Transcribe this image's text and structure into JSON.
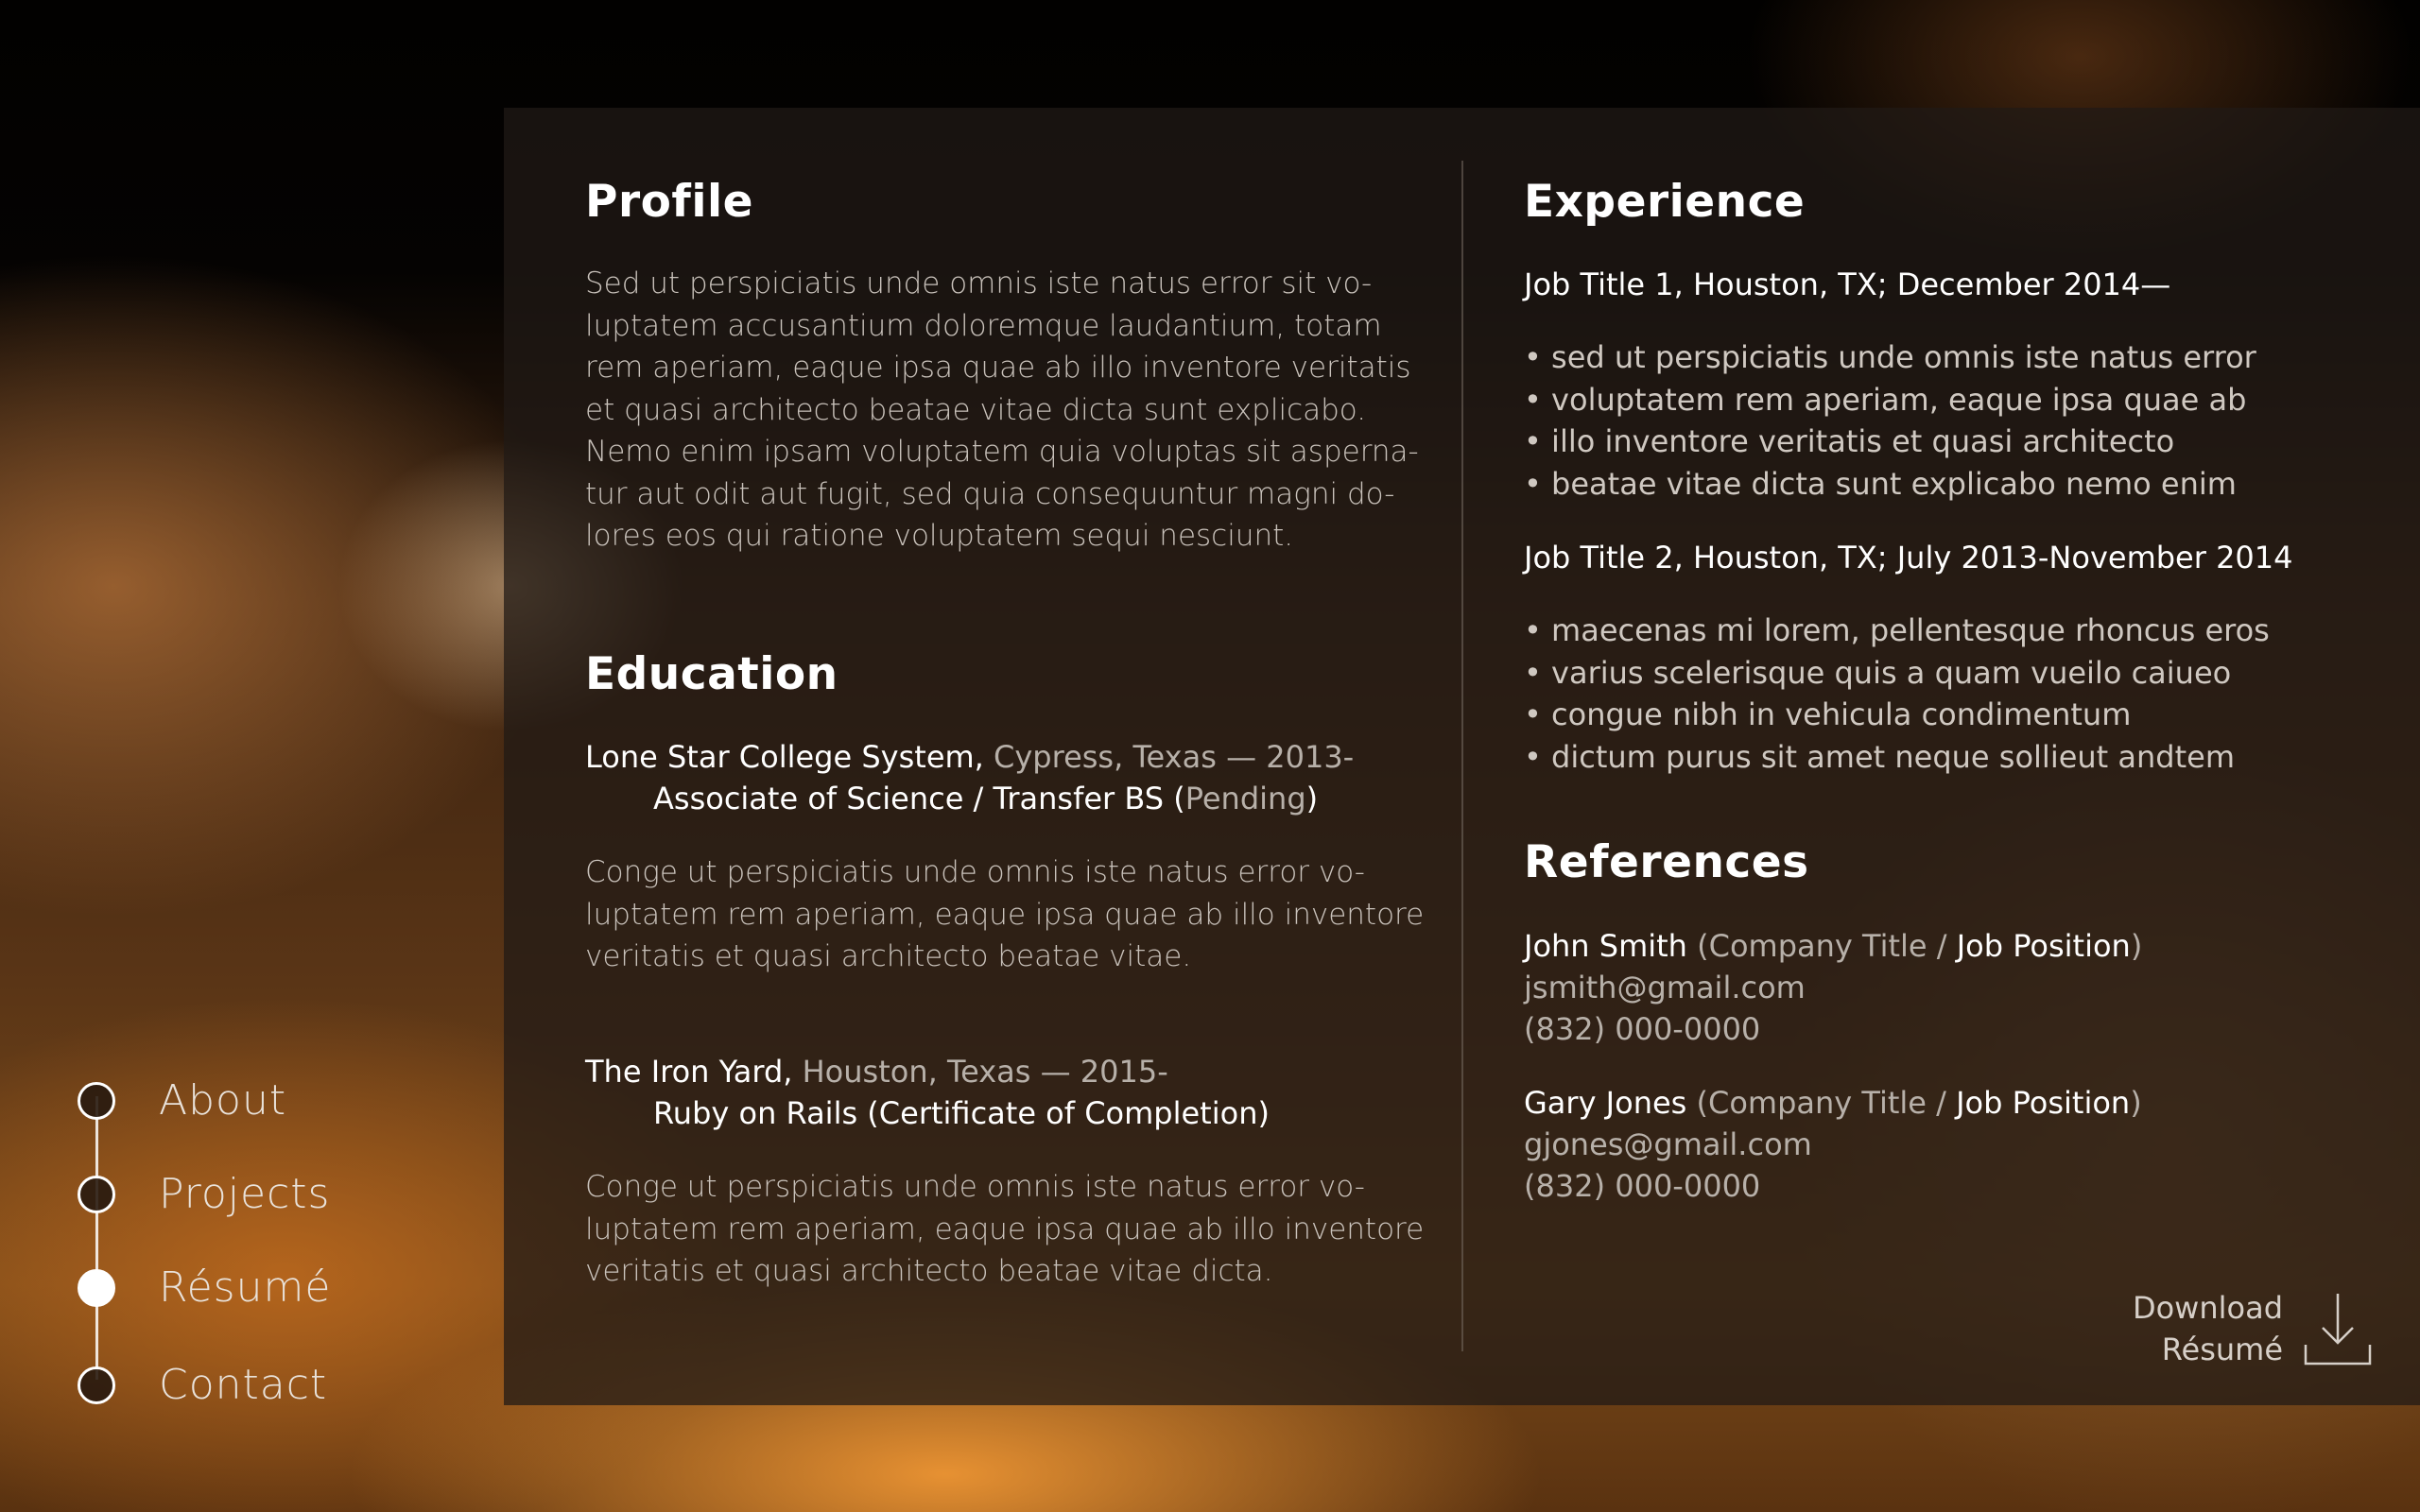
{
  "nav": {
    "items": [
      {
        "label": "About",
        "active": false
      },
      {
        "label": "Projects",
        "active": false
      },
      {
        "label": "Résumé",
        "active": true
      },
      {
        "label": "Contact",
        "active": false
      }
    ]
  },
  "profile": {
    "heading": "Profile",
    "text": "Sed ut perspiciatis unde omnis iste natus error sit vo-\nluptatem accusantium doloremque laudantium, totam\nrem aperiam, eaque ipsa quae ab illo inventore veritatis\net quasi architecto beatae vitae dicta sunt explicabo.\nNemo enim ipsam voluptatem quia voluptas sit asperna-\ntur aut odit aut fugit, sed quia consequuntur magni do-\nlores eos qui ratione voluptatem sequi nesciunt."
  },
  "education": {
    "heading": "Education",
    "entries": [
      {
        "school": "Lone Star College System,",
        "location": " Cypress, Texas — 2013-",
        "degree": "Associate of Science / Transfer BS (",
        "degree_status": "Pending",
        "degree_close": ")",
        "text": "Conge ut perspiciatis unde omnis iste natus error vo-\nluptatem rem aperiam, eaque ipsa quae ab illo inventore\nveritatis et quasi architecto beatae vitae."
      },
      {
        "school": "The Iron Yard,",
        "location": " Houston, Texas — 2015-",
        "degree": "Ruby on Rails (Certificate of Completion)",
        "text": "Conge ut perspiciatis unde omnis iste natus error vo-\nluptatem rem aperiam, eaque ipsa quae ab illo inventore\nveritatis et quasi architecto beatae vitae dicta."
      }
    ]
  },
  "experience": {
    "heading": "Experience",
    "jobs": [
      {
        "title": "Job Title 1, Houston, TX; December 2014—",
        "bullets": [
          "• sed ut perspiciatis unde omnis iste natus error",
          "• voluptatem rem aperiam, eaque ipsa quae ab",
          "• illo inventore veritatis et quasi architecto",
          "• beatae vitae dicta sunt explicabo nemo enim"
        ]
      },
      {
        "title": "Job Title 2, Houston, TX; July 2013-November 2014",
        "bullets": [
          "• maecenas mi lorem, pellentesque rhoncus eros",
          "• varius scelerisque quis a quam vueilo caiueo",
          "• congue nibh in vehicula condimentum",
          "• dictum purus sit amet neque sollieut andtem"
        ]
      }
    ]
  },
  "references": {
    "heading": "References",
    "people": [
      {
        "name": "John Smith",
        "company_open": " (Company Title / ",
        "position": "Job Position",
        "close": ")",
        "email": "jsmith@gmail.com",
        "phone": "(832) 000-0000"
      },
      {
        "name": "Gary Jones",
        "company_open": " (Company Title / ",
        "position": "Job Position",
        "close": ")",
        "email": "gjones@gmail.com",
        "phone": "(832) 000-0000"
      }
    ]
  },
  "download": {
    "label": "Download\nRésumé",
    "icon": "download-icon"
  }
}
